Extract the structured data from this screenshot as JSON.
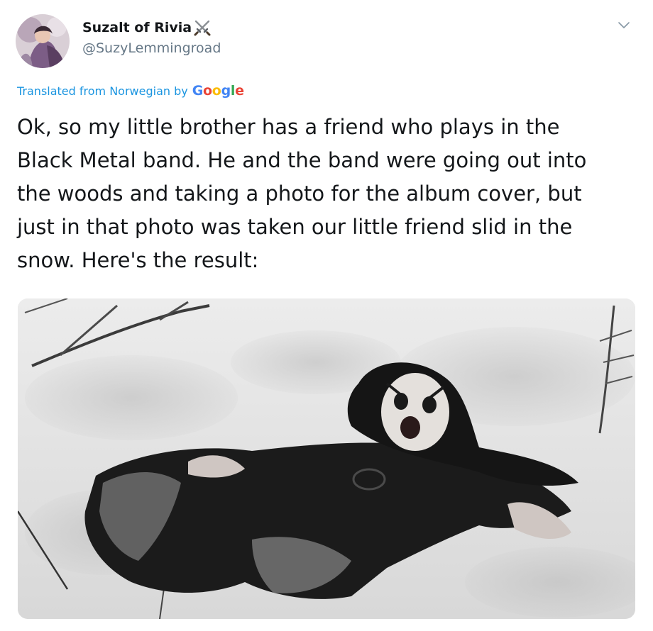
{
  "user": {
    "display_name": "Suzalt of Rivia",
    "name_emoji_icon": "crossed-swords-icon",
    "handle": "@SuzyLemmingroad"
  },
  "menu_icon": "chevron-down-icon",
  "translation": {
    "label": "Translated from Norwegian by",
    "provider_letters": [
      "G",
      "o",
      "o",
      "g",
      "l",
      "e"
    ]
  },
  "tweet_lines": [
    "Ok, so my little brother has a friend who plays in the",
    "Black Metal band. He and the band were going out into",
    "the woods and taking a photo for the album cover, but",
    "just in that photo was taken our little friend slid in the",
    "snow. Here's the result:"
  ],
  "colors": {
    "handle": "#657786",
    "link": "#1b95e0",
    "text": "#14171a"
  }
}
